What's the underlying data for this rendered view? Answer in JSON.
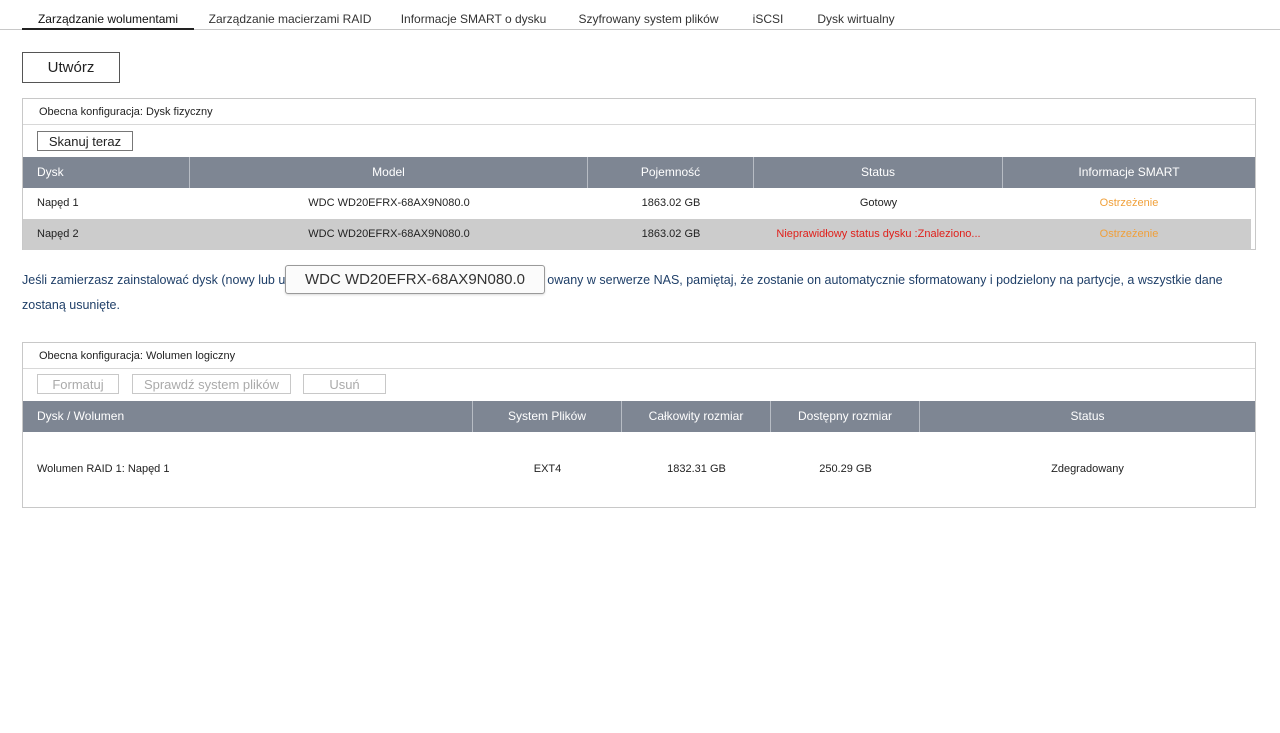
{
  "tabs": [
    {
      "label": "Zarządzanie wolumentami",
      "active": true
    },
    {
      "label": "Zarządzanie macierzami RAID"
    },
    {
      "label": "Informacje SMART o dysku"
    },
    {
      "label": "Szyfrowany system plików"
    },
    {
      "label": "iSCSI"
    },
    {
      "label": "Dysk wirtualny"
    }
  ],
  "create_button": "Utwórz",
  "physical": {
    "title": "Obecna konfiguracja: Dysk fizyczny",
    "scan_button": "Skanuj teraz",
    "columns": [
      "Dysk",
      "Model",
      "Pojemność",
      "Status",
      "Informacje SMART"
    ],
    "rows": [
      {
        "disk": "Napęd 1",
        "model": "WDC WD20EFRX-68AX9N080.0",
        "capacity": "1863.02 GB",
        "status": "Gotowy",
        "smart": "Ostrzeżenie"
      },
      {
        "disk": "Napęd 2",
        "model": "WDC WD20EFRX-68AX9N080.0",
        "capacity": "1863.02 GB",
        "status": "Nieprawidłowy status dysku :Znaleziono...",
        "smart": "Ostrzeżenie"
      }
    ]
  },
  "info": {
    "line1_a": "Jeśli zamierzasz zainstalować dysk (nowy lub u",
    "line1_b": "owany w serwerze NAS, pamiętaj, że zostanie on automatycznie sformatowany i podzielony na partycje, a wszystkie dane",
    "line2": "zostaną usunięte."
  },
  "tooltip": "WDC WD20EFRX-68AX9N080.0",
  "logical": {
    "title": "Obecna konfiguracja: Wolumen logiczny",
    "buttons": [
      "Formatuj",
      "Sprawdź system plików",
      "Usuń"
    ],
    "columns": [
      "Dysk / Wolumen",
      "System Plików",
      "Całkowity rozmiar",
      "Dostępny rozmiar",
      "Status"
    ],
    "rows": [
      {
        "volume": "Wolumen RAID 1: Napęd 1",
        "fs": "EXT4",
        "total": "1832.31 GB",
        "free": "250.29 GB",
        "status": "Zdegradowany"
      }
    ]
  },
  "colors": {
    "header_bg": "#7e8693",
    "warning": "#f0a03a",
    "error": "#e0201b",
    "selected_row": "#cccccc"
  }
}
